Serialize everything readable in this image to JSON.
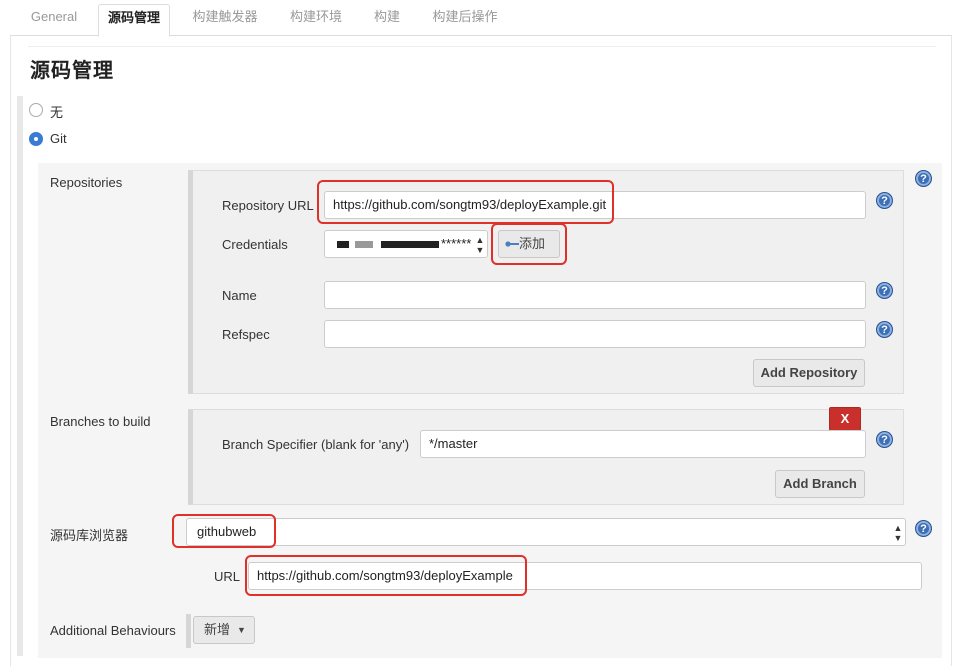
{
  "tabs": [
    {
      "label": "General"
    },
    {
      "label": "源码管理"
    },
    {
      "label": "构建触发器"
    },
    {
      "label": "构建环境"
    },
    {
      "label": "构建"
    },
    {
      "label": "构建后操作"
    }
  ],
  "section": {
    "title": "源码管理"
  },
  "scm_options": [
    {
      "label": "无",
      "selected": false
    },
    {
      "label": "Git",
      "selected": true
    }
  ],
  "repositories": {
    "label": "Repositories",
    "url_label": "Repository URL",
    "url_value": "https://github.com/songtm93/deployExample.git",
    "credentials_label": "Credentials",
    "credentials_suffix": "******",
    "add_credentials_label": "添加",
    "name_label": "Name",
    "name_value": "",
    "refspec_label": "Refspec",
    "refspec_value": "",
    "add_repository_label": "Add Repository"
  },
  "branches": {
    "label": "Branches to build",
    "delete_label": "X",
    "specifier_label": "Branch Specifier (blank for 'any')",
    "specifier_value": "*/master",
    "add_branch_label": "Add Branch"
  },
  "browser": {
    "label": "源码库浏览器",
    "selected": "githubweb",
    "url_label": "URL",
    "url_value": "https://github.com/songtm93/deployExample"
  },
  "additional_behaviours": {
    "label": "Additional Behaviours",
    "add_label": "新增"
  },
  "help_text": "?",
  "colors": {
    "highlight": "#e0302a",
    "help_icon": "#3d6fb5",
    "delete_button": "#c9302c",
    "radio_selected": "#3a7bd5"
  }
}
